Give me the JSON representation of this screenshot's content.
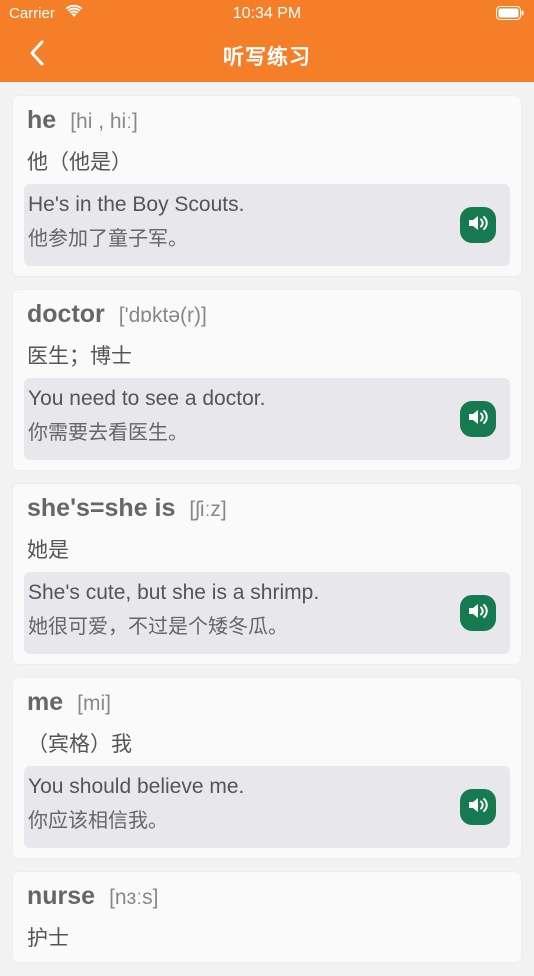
{
  "status_bar": {
    "carrier": "Carrier",
    "time": "10:34 PM"
  },
  "nav": {
    "title": "听写练习"
  },
  "cards": [
    {
      "word": "he",
      "phonetic": "[hi , hiː]",
      "meaning": "他（他是）",
      "example_en": "He's in the Boy Scouts.",
      "example_zh": "他参加了童子军。"
    },
    {
      "word": "doctor",
      "phonetic": "['dɒktə(r)]",
      "meaning": "医生；博士",
      "example_en": "You need to see a doctor.",
      "example_zh": "你需要去看医生。"
    },
    {
      "word": "she's=she is",
      "phonetic": "[ʃiːz]",
      "meaning": "她是",
      "example_en": "She's cute, but she is a shrimp.",
      "example_zh": "她很可爱，不过是个矮冬瓜。"
    },
    {
      "word": "me",
      "phonetic": "[mi]",
      "meaning": "（宾格）我",
      "example_en": "You should believe me.",
      "example_zh": "你应该相信我。"
    },
    {
      "word": "nurse",
      "phonetic": "[nɜːs]",
      "meaning": "护士"
    }
  ],
  "colors": {
    "accent": "#f57f29",
    "sound_button": "#167a50"
  },
  "icons": {
    "back": "chevron-left-icon",
    "sound": "speaker-icon",
    "wifi": "wifi-icon",
    "battery": "battery-icon"
  }
}
